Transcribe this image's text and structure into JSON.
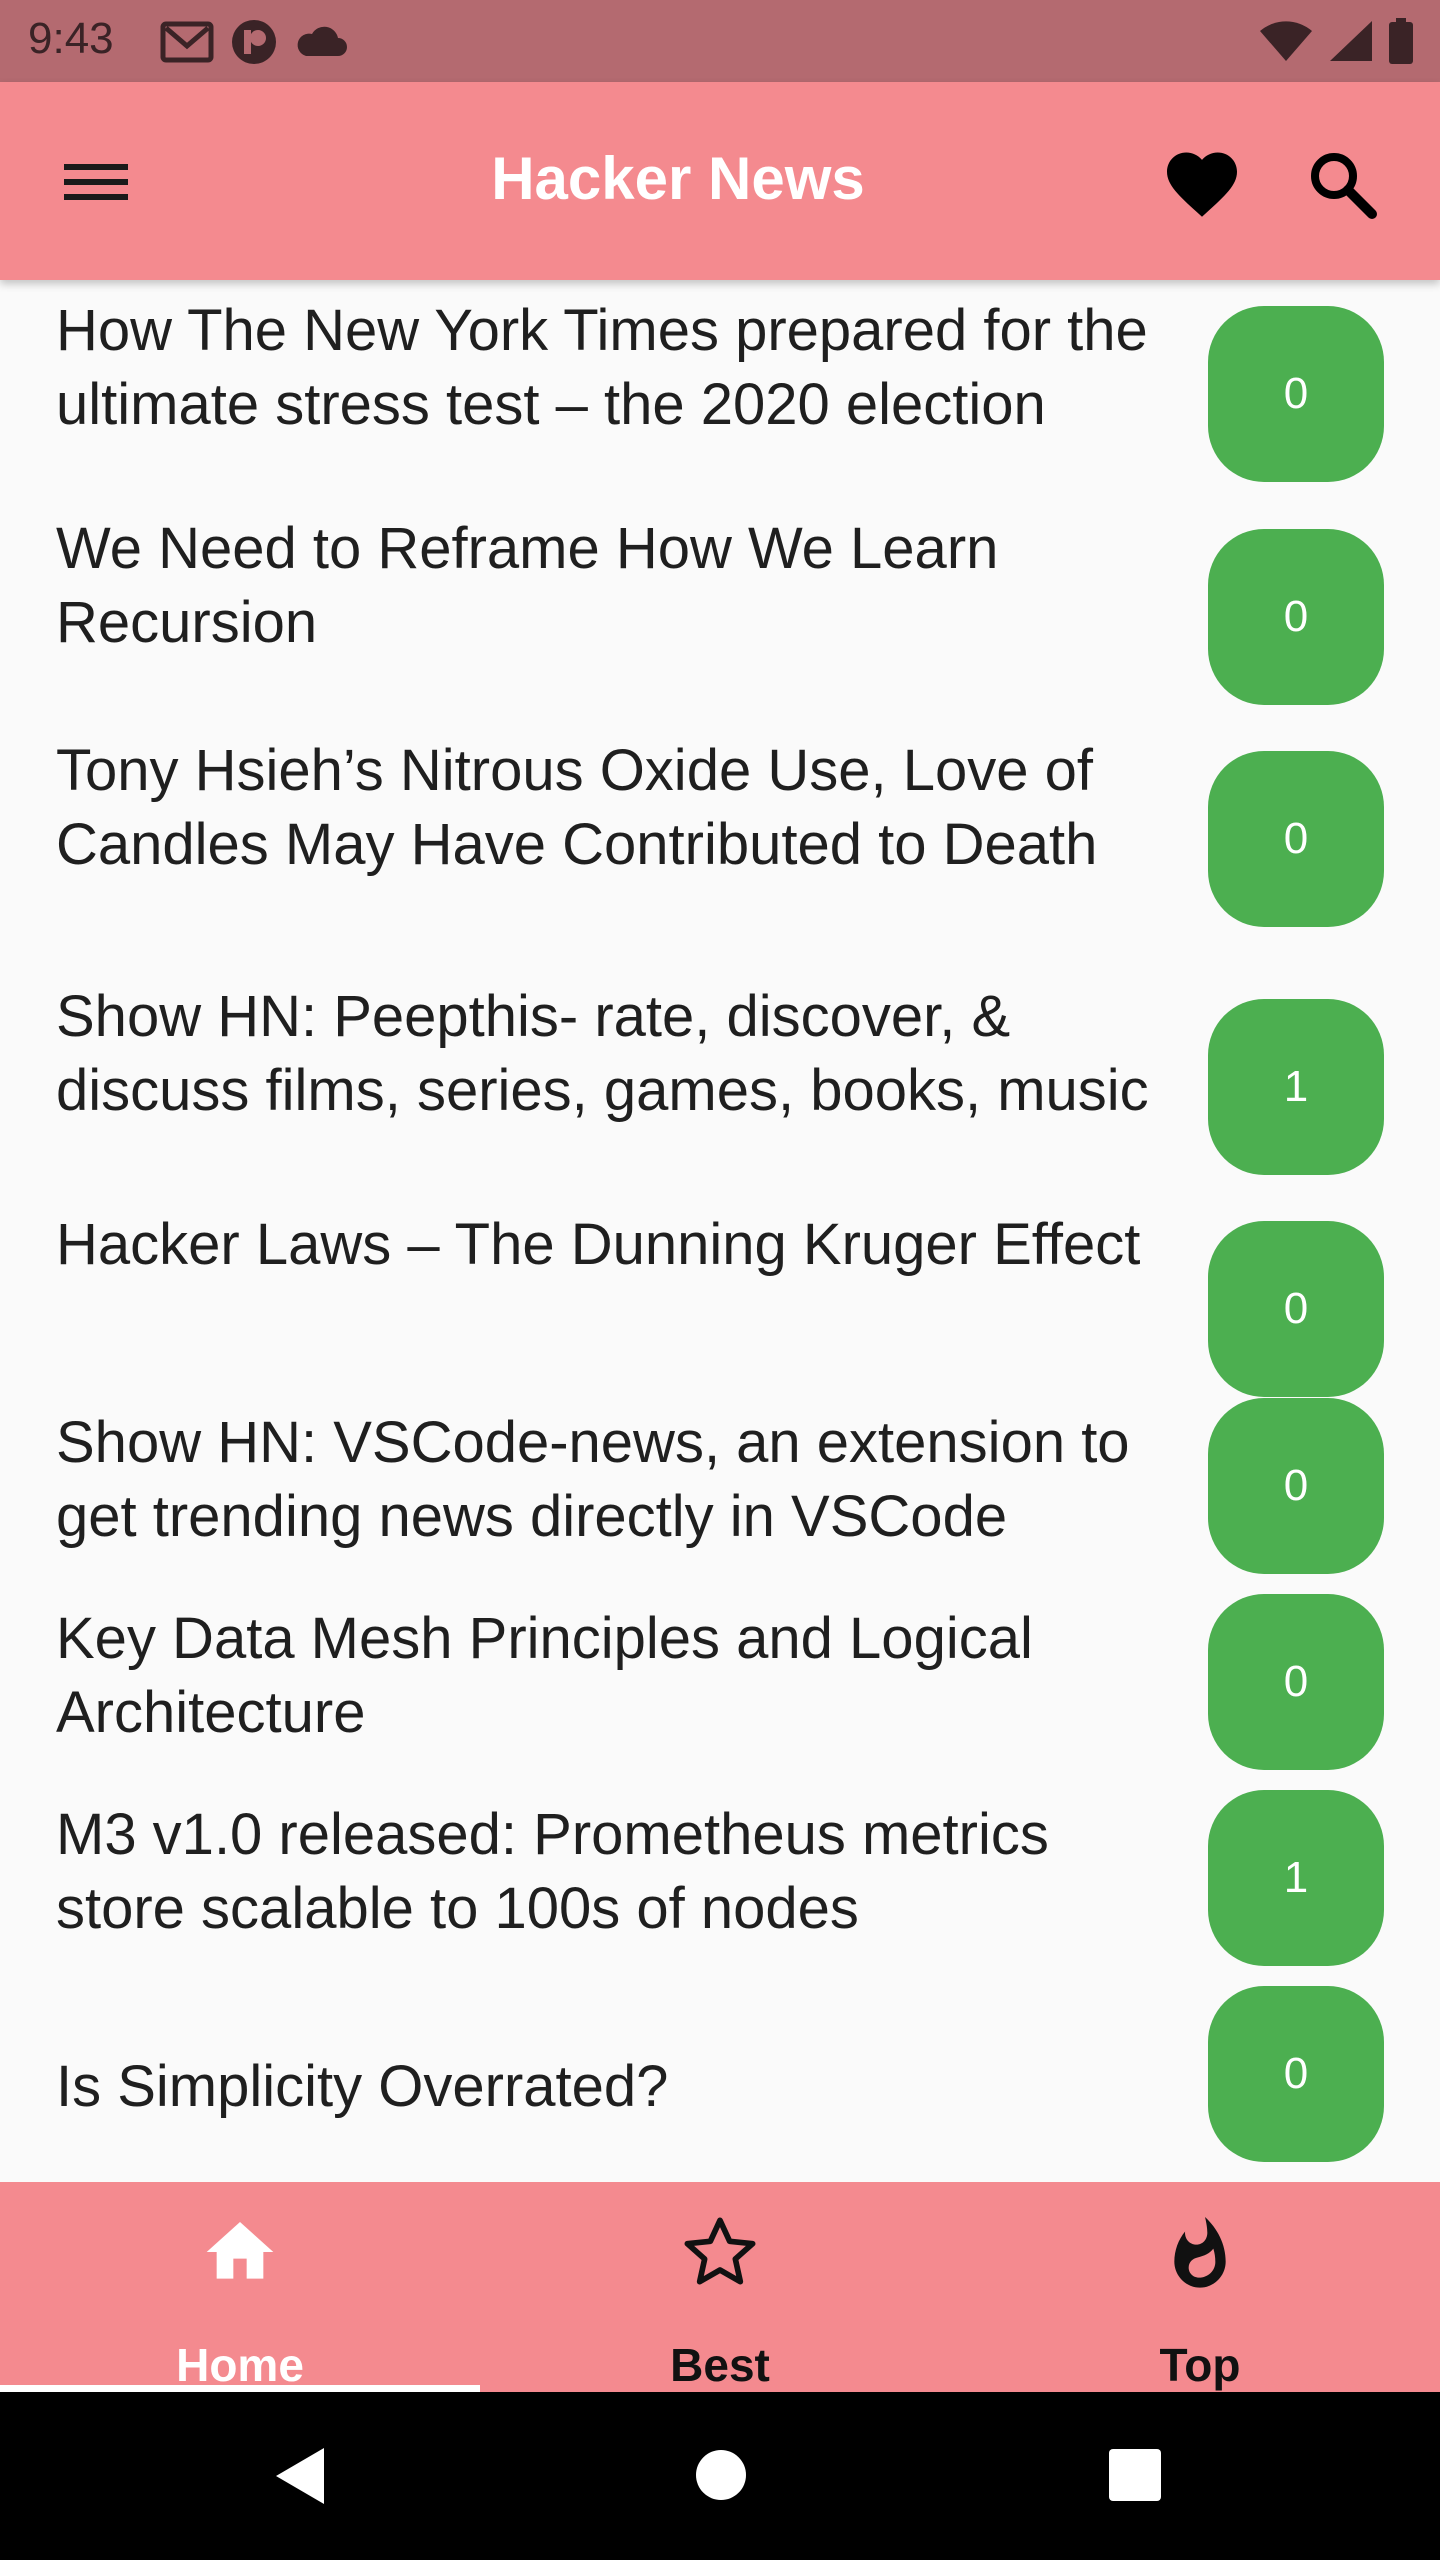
{
  "status_bar": {
    "time": "9:43",
    "left_icons": [
      "gmail-icon",
      "app-notification-icon",
      "cloud-icon"
    ],
    "right_icons": [
      "wifi-icon",
      "cell-signal-icon",
      "battery-icon"
    ]
  },
  "app_bar": {
    "title": "Hacker News",
    "icons": [
      "menu-icon",
      "heart-icon",
      "search-icon"
    ]
  },
  "stories": [
    {
      "title": "How The New York Times prepared for the ultimate stress test – the 2020 election",
      "count": "0"
    },
    {
      "title": "We Need to Reframe How We Learn Recursion",
      "count": "0"
    },
    {
      "title": "Tony Hsieh’s Nitrous Oxide Use, Love of Candles May Have Contributed to Death",
      "count": "0"
    },
    {
      "title": "Show HN: Peepthis- rate, discover, & discuss films, series, games, books, music",
      "count": "1"
    },
    {
      "title": "Hacker Laws – The Dunning Kruger Effect",
      "count": "0"
    },
    {
      "title": "Show HN: VSCode-news, an extension to get trending news directly in VSCode",
      "count": "0"
    },
    {
      "title": "Key Data Mesh Principles and Logical Architecture",
      "count": "0"
    },
    {
      "title": "M3 v1.0 released: Prometheus metrics store scalable to 100s of nodes",
      "count": "1"
    },
    {
      "title": "Is Simplicity Overrated?",
      "count": "0"
    }
  ],
  "bottom_nav": {
    "items": [
      {
        "label": "Home",
        "icon": "home-icon",
        "selected": true
      },
      {
        "label": "Best",
        "icon": "star-outline-icon",
        "selected": false
      },
      {
        "label": "Top",
        "icon": "fire-icon",
        "selected": false
      }
    ]
  },
  "system_nav": [
    "back-icon",
    "home-circle-icon",
    "recents-icon"
  ],
  "colors": {
    "status_bar": "#b46a70",
    "app_bar": "#f48a8f",
    "badge": "#4caf50",
    "background": "#fafafa",
    "nav_selected": "#ffffff",
    "nav_unselected": "#111111"
  }
}
